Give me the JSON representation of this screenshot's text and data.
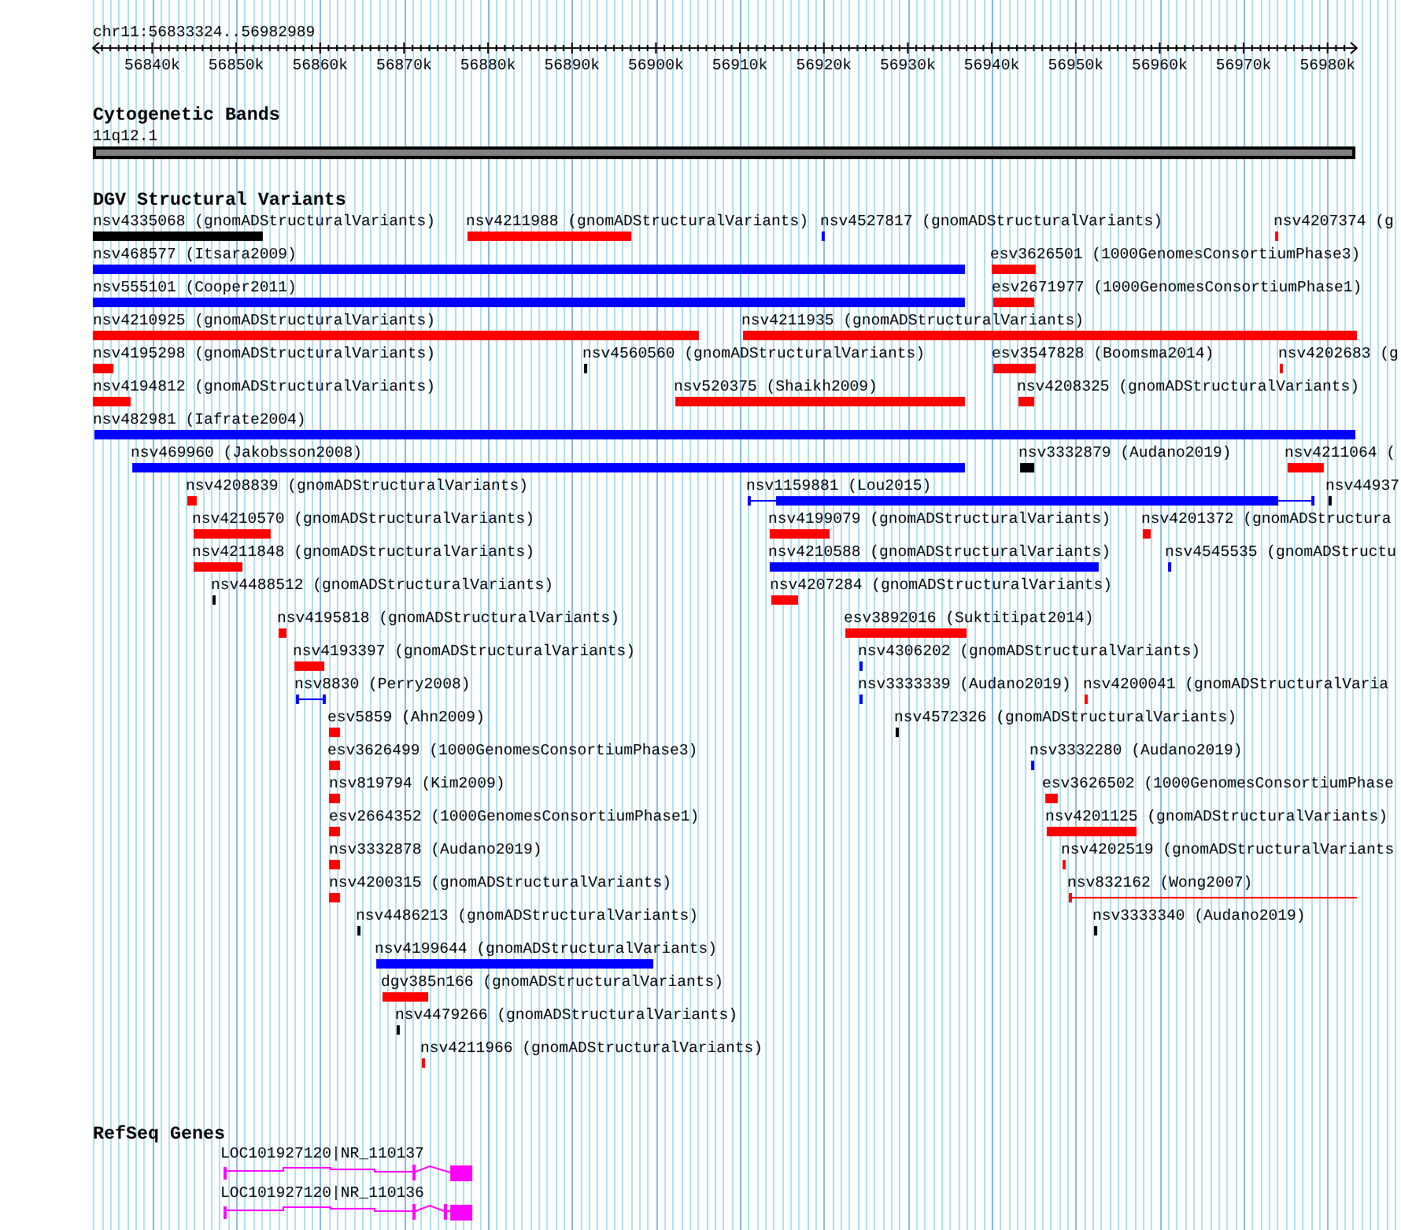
{
  "ruler": {
    "region": "chr11:56833324..56982989",
    "ticks": [
      "56840k",
      "56850k",
      "56860k",
      "56870k",
      "56880k",
      "56890k",
      "56900k",
      "56910k",
      "56920k",
      "56930k",
      "56940k",
      "56950k",
      "56960k",
      "56970k",
      "56980k"
    ]
  },
  "cytogenetic_bands": {
    "title": "Cytogenetic Bands",
    "bands": [
      {
        "label": "11q12.1"
      }
    ]
  },
  "dgv_structural_variants": {
    "title": "DGV Structural Variants",
    "features": [
      {
        "label": "nsv4335068 (gnomADStructuralVariants)",
        "color": "#000000",
        "kind": "block"
      },
      {
        "label": "nsv4211988 (gnomADStructuralVariants)",
        "color": "#ff0000",
        "kind": "block"
      },
      {
        "label": "nsv4527817 (gnomADStructuralVariants)",
        "color": "#0000ff",
        "kind": "block"
      },
      {
        "label": "nsv4207374 (g",
        "color": "#ff0000",
        "kind": "block"
      },
      {
        "label": "nsv468577 (Itsara2009)",
        "color": "#0000ff",
        "kind": "block"
      },
      {
        "label": "esv3626501 (1000GenomesConsortiumPhase3)",
        "color": "#ff0000",
        "kind": "block"
      },
      {
        "label": "nsv555101 (Cooper2011)",
        "color": "#0000ff",
        "kind": "block"
      },
      {
        "label": "esv2671977 (1000GenomesConsortiumPhase1)",
        "color": "#ff0000",
        "kind": "block"
      },
      {
        "label": "nsv4210925 (gnomADStructuralVariants)",
        "color": "#ff0000",
        "kind": "block"
      },
      {
        "label": "nsv4211935 (gnomADStructuralVariants)",
        "color": "#ff0000",
        "kind": "block"
      },
      {
        "label": "nsv4195298 (gnomADStructuralVariants)",
        "color": "#ff0000",
        "kind": "block"
      },
      {
        "label": "nsv4560560 (gnomADStructuralVariants)",
        "color": "#000000",
        "kind": "block"
      },
      {
        "label": "esv3547828 (Boomsma2014)",
        "color": "#ff0000",
        "kind": "block"
      },
      {
        "label": "nsv4202683 (g",
        "color": "#ff0000",
        "kind": "block"
      },
      {
        "label": "nsv4194812 (gnomADStructuralVariants)",
        "color": "#ff0000",
        "kind": "block"
      },
      {
        "label": "nsv520375 (Shaikh2009)",
        "color": "#ff0000",
        "kind": "block"
      },
      {
        "label": "nsv4208325 (gnomADStructuralVariants)",
        "color": "#ff0000",
        "kind": "block"
      },
      {
        "label": "nsv482981 (Iafrate2004)",
        "color": "#0000ff",
        "kind": "block"
      },
      {
        "label": "nsv469960 (Jakobsson2008)",
        "color": "#0000ff",
        "kind": "block"
      },
      {
        "label": "nsv3332879 (Audano2019)",
        "color": "#000000",
        "kind": "block"
      },
      {
        "label": "nsv4211064 (",
        "color": "#ff0000",
        "kind": "block"
      },
      {
        "label": "nsv4208839 (gnomADStructuralVariants)",
        "color": "#ff0000",
        "kind": "block"
      },
      {
        "label": "nsv1159881 (Lou2015)",
        "color": "#0000ff",
        "kind": "block-interval"
      },
      {
        "label": "nsv44937",
        "color": "#000000",
        "kind": "block"
      },
      {
        "label": "nsv4210570 (gnomADStructuralVariants)",
        "color": "#ff0000",
        "kind": "block"
      },
      {
        "label": "nsv4199079 (gnomADStructuralVariants)",
        "color": "#ff0000",
        "kind": "block"
      },
      {
        "label": "nsv4201372 (gnomADStructura",
        "color": "#ff0000",
        "kind": "block"
      },
      {
        "label": "nsv4211848 (gnomADStructuralVariants)",
        "color": "#ff0000",
        "kind": "block"
      },
      {
        "label": "nsv4210588 (gnomADStructuralVariants)",
        "color": "#0000ff",
        "kind": "block"
      },
      {
        "label": "nsv4545535 (gnomADStructu",
        "color": "#0000ff",
        "kind": "block"
      },
      {
        "label": "nsv4488512 (gnomADStructuralVariants)",
        "color": "#000000",
        "kind": "block"
      },
      {
        "label": "nsv4207284 (gnomADStructuralVariants)",
        "color": "#ff0000",
        "kind": "block"
      },
      {
        "label": "nsv4195818 (gnomADStructuralVariants)",
        "color": "#ff0000",
        "kind": "block"
      },
      {
        "label": "esv3892016 (Suktitipat2014)",
        "color": "#ff0000",
        "kind": "block"
      },
      {
        "label": "nsv4193397 (gnomADStructuralVariants)",
        "color": "#ff0000",
        "kind": "block"
      },
      {
        "label": "nsv4306202 (gnomADStructuralVariants)",
        "color": "#0000ff",
        "kind": "block"
      },
      {
        "label": "nsv8830 (Perry2008)",
        "color": "#0000ff",
        "kind": "interval"
      },
      {
        "label": "nsv3333339 (Audano2019)",
        "color": "#0000ff",
        "kind": "block"
      },
      {
        "label": "nsv4200041 (gnomADStructuralVaria",
        "color": "#ff0000",
        "kind": "block"
      },
      {
        "label": "esv5859 (Ahn2009)",
        "color": "#ff0000",
        "kind": "block"
      },
      {
        "label": "nsv4572326 (gnomADStructuralVariants)",
        "color": "#000000",
        "kind": "block"
      },
      {
        "label": "esv3626499 (1000GenomesConsortiumPhase3)",
        "color": "#ff0000",
        "kind": "block"
      },
      {
        "label": "nsv3332280 (Audano2019)",
        "color": "#0000ff",
        "kind": "block"
      },
      {
        "label": "nsv819794 (Kim2009)",
        "color": "#ff0000",
        "kind": "block"
      },
      {
        "label": "esv3626502 (1000GenomesConsortiumPhase",
        "color": "#ff0000",
        "kind": "block"
      },
      {
        "label": "esv2664352 (1000GenomesConsortiumPhase1)",
        "color": "#ff0000",
        "kind": "block"
      },
      {
        "label": "nsv4201125 (gnomADStructuralVariants)",
        "color": "#ff0000",
        "kind": "block"
      },
      {
        "label": "nsv3332878 (Audano2019)",
        "color": "#ff0000",
        "kind": "block"
      },
      {
        "label": "nsv4202519 (gnomADStructuralVariants",
        "color": "#ff0000",
        "kind": "block"
      },
      {
        "label": "nsv4200315 (gnomADStructuralVariants)",
        "color": "#ff0000",
        "kind": "block"
      },
      {
        "label": "nsv832162 (Wong2007)",
        "color": "#ff0000",
        "kind": "interval"
      },
      {
        "label": "nsv4486213 (gnomADStructuralVariants)",
        "color": "#000000",
        "kind": "block"
      },
      {
        "label": "nsv3333340 (Audano2019)",
        "color": "#000000",
        "kind": "block"
      },
      {
        "label": "nsv4199644 (gnomADStructuralVariants)",
        "color": "#0000ff",
        "kind": "block"
      },
      {
        "label": "dgv385n166 (gnomADStructuralVariants)",
        "color": "#ff0000",
        "kind": "block"
      },
      {
        "label": "nsv4479266 (gnomADStructuralVariants)",
        "color": "#000000",
        "kind": "block"
      },
      {
        "label": "nsv4211966 (gnomADStructuralVariants)",
        "color": "#ff0000",
        "kind": "block"
      }
    ]
  },
  "refseq_genes": {
    "title": "RefSeq Genes",
    "transcripts": [
      {
        "label": "LOC101927120|NR_110137"
      },
      {
        "label": "LOC101927120|NR_110136"
      }
    ]
  }
}
